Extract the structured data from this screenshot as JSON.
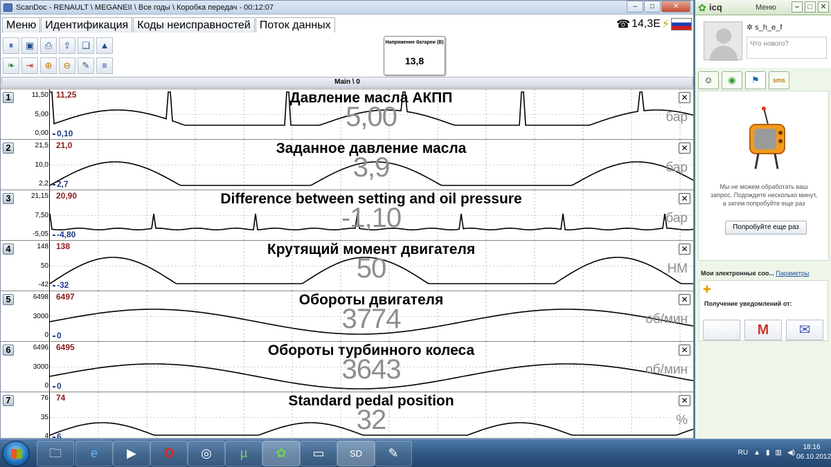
{
  "window": {
    "title": "ScanDoc - RENAULT \\ MEGANEII \\ Все годы \\ Коробка передач - 00:12:07",
    "min": "–",
    "max": "□",
    "close": "✕"
  },
  "menu": {
    "tabs": [
      "Меню",
      "Идентификация",
      "Коды неисправностей",
      "Поток данных"
    ]
  },
  "topright": {
    "voltage": "14,3Е"
  },
  "battery": {
    "label": "Напряжение батареи (В)",
    "value": "13,8"
  },
  "main_bar": "Main \\ 0",
  "panels": [
    {
      "num": "1",
      "title": "Давление масла АКПП",
      "value": "5,00",
      "unit": "бар",
      "scale_top": "11,50",
      "scale_mid": "5,00",
      "scale_bot": "0,00",
      "max": "11,25",
      "min": "0,10"
    },
    {
      "num": "2",
      "title": "Заданное давление масла",
      "value": "3,9",
      "unit": "бар",
      "scale_top": "21,5",
      "scale_mid": "10,0",
      "scale_bot": "2,2",
      "max": "21,0",
      "min": "2,7"
    },
    {
      "num": "3",
      "title": "Difference between setting and oil pressure",
      "value": "-1,10",
      "unit": "бар",
      "scale_top": "21,15",
      "scale_mid": "7,50",
      "scale_bot": "-5,05",
      "max": "20,90",
      "min": "-4,80"
    },
    {
      "num": "4",
      "title": "Крутящий момент двигателя",
      "value": "50",
      "unit": "НМ",
      "scale_top": "148",
      "scale_mid": "50",
      "scale_bot": "-42",
      "max": "138",
      "min": "-32"
    },
    {
      "num": "5",
      "title": "Обороты двигателя",
      "value": "3774",
      "unit": "об/мин",
      "scale_top": "6498",
      "scale_mid": "3000",
      "scale_bot": "0",
      "max": "6497",
      "min": "0"
    },
    {
      "num": "6",
      "title": "Обороты турбинного колеса",
      "value": "3643",
      "unit": "об/мин",
      "scale_top": "6496",
      "scale_mid": "3000",
      "scale_bot": "0",
      "max": "6495",
      "min": "0"
    },
    {
      "num": "7",
      "title": "Standard pedal position",
      "value": "32",
      "unit": "%",
      "scale_top": "76",
      "scale_mid": "35",
      "scale_bot": "4",
      "max": "74",
      "min": "6"
    }
  ],
  "icq": {
    "app": "icq",
    "menu": "Меню",
    "username": "s_h_e_f",
    "status_placeholder": "Что нового?",
    "error_text": "Мы не можем обработать ваш запрос. Подождите несколько минут, а затем попробуйте еще раз",
    "retry_button": "Попробуйте еще раз",
    "mail_title": "Мои электронные соо...",
    "mail_params": "Параметры",
    "mail_notif": "Получение уведомлений от:"
  },
  "taskbar": {
    "lang": "RU",
    "time": "18:16",
    "date": "06.10.2012"
  }
}
